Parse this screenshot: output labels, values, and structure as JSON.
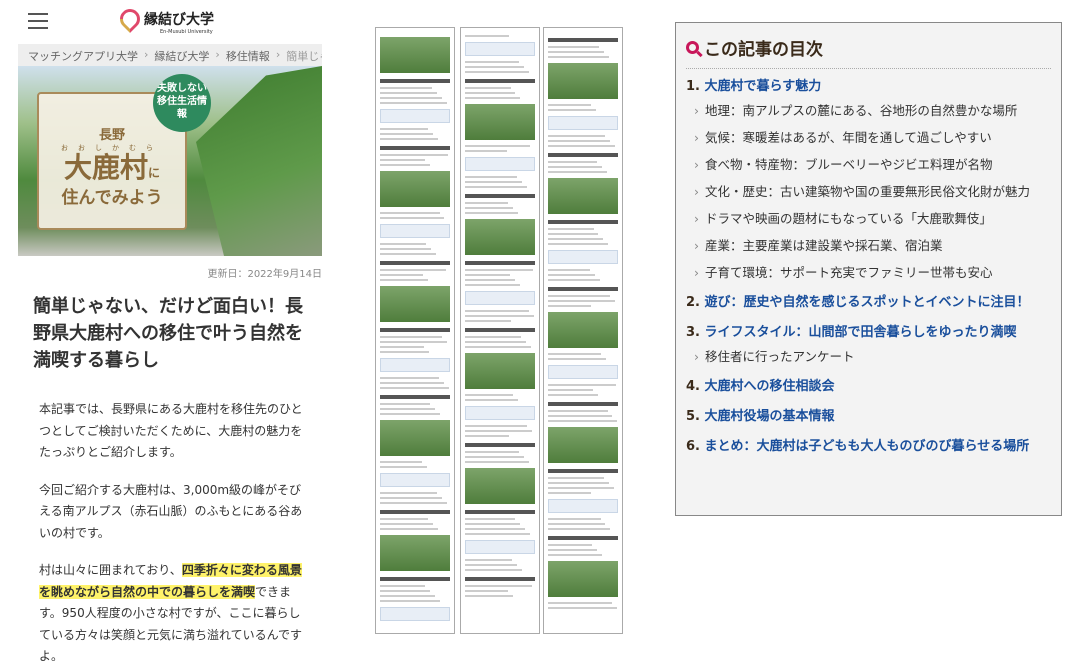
{
  "header": {
    "logo_title": "縁結び大学",
    "logo_sub": "En-Musubi University"
  },
  "breadcrumb": [
    "マッチングアプリ大学",
    "縁結び大学",
    "移住情報",
    "簡単じゃない、"
  ],
  "hero": {
    "badge": "失敗しない移住生活情報",
    "pref": "長野",
    "ruby": "おおしかむら",
    "village": "大鹿村",
    "suffix": "に",
    "tagline": "住んでみよう"
  },
  "updated": "更新日：2022年9月14日",
  "title": "簡単じゃない、だけど面白い！長野県大鹿村への移住で叶う自然を満喫する暮らし",
  "body": {
    "p1": "本記事では、長野県にある大鹿村を移住先のひとつとしてご検討いただくために、大鹿村の魅力をたっぷりとご紹介します。",
    "p2": "今回ご紹介する大鹿村は、3,000m級の峰がそびえる南アルプス（赤石山脈）のふもとにある谷あいの村です。",
    "p3a": "村は山々に囲まれており、",
    "p3hl": "四季折々に変わる風景を眺めながら自然の中での暮らしを満喫",
    "p3b": "できます。950人程度の小さな村ですが、ここに暮らしている方々は笑顔と元気に満ち溢れているんですよ。"
  },
  "toc": {
    "heading": "この記事の目次",
    "sections": [
      {
        "num": "1.",
        "label": "大鹿村で暮らす魅力",
        "subs": [
          "地理：南アルプスの麓にある、谷地形の自然豊かな場所",
          "気候：寒暖差はあるが、年間を通して過ごしやすい",
          "食べ物・特産物：ブルーベリーやジビエ料理が名物",
          "文化・歴史：古い建築物や国の重要無形民俗文化財が魅力",
          "ドラマや映画の題材にもなっている「大鹿歌舞伎」",
          "産業：主要産業は建設業や採石業、宿泊業",
          "子育て環境：サポート充実でファミリー世帯も安心"
        ]
      },
      {
        "num": "2.",
        "label": "遊び：歴史や自然を感じるスポットとイベントに注目！",
        "subs": []
      },
      {
        "num": "3.",
        "label": "ライフスタイル：山間部で田舎暮らしをゆったり満喫",
        "subs": [
          "移住者に行ったアンケート"
        ]
      },
      {
        "num": "4.",
        "label": "大鹿村への移住相談会",
        "subs": []
      },
      {
        "num": "5.",
        "label": "大鹿村役場の基本情報",
        "subs": []
      },
      {
        "num": "6.",
        "label": "まとめ：大鹿村は子どもも大人ものびのび暮らせる場所",
        "subs": []
      }
    ]
  }
}
